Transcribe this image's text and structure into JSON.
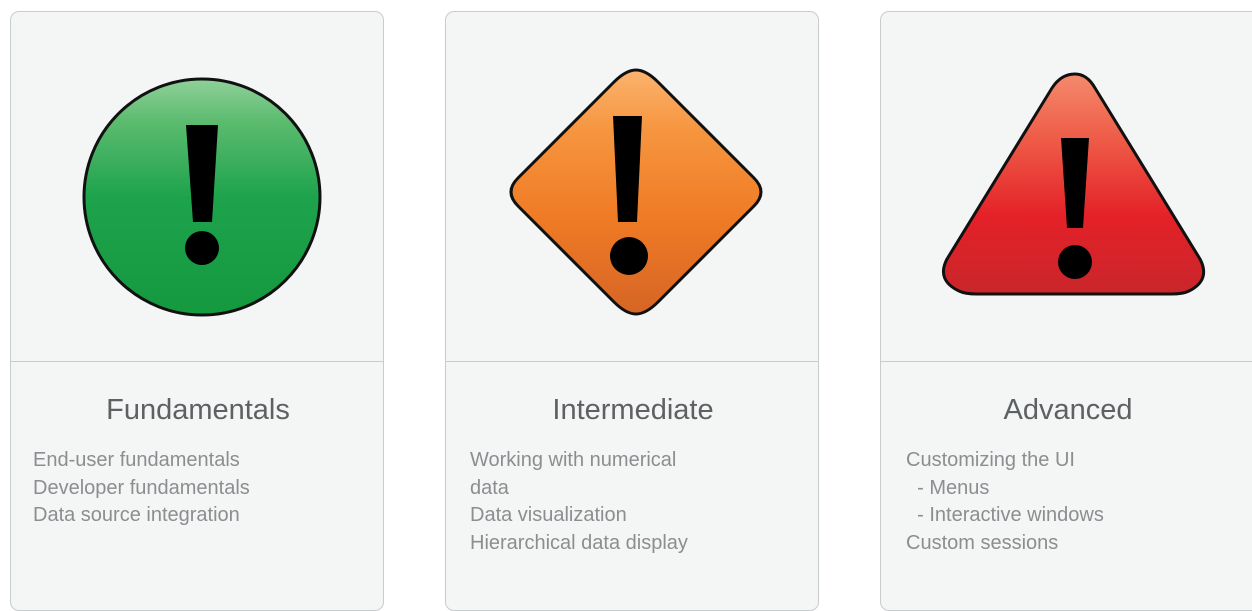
{
  "cards": [
    {
      "title": "Fundamentals",
      "icon": "green-circle-warning-icon",
      "items": [
        "End-user fundamentals",
        "Developer fundamentals",
        "Data source integration"
      ]
    },
    {
      "title": "Intermediate",
      "icon": "orange-diamond-warning-icon",
      "items": [
        "Working with numerical",
        "data",
        "Data visualization",
        "Hierarchical data display"
      ]
    },
    {
      "title": "Advanced",
      "icon": "red-triangle-warning-icon",
      "items": [
        "Customizing the UI",
        "  - Menus",
        "  - Interactive windows",
        "Custom sessions"
      ]
    }
  ],
  "colors": {
    "card_background": "#f4f5f5",
    "card_border": "#c9cccd",
    "title_text": "#5e6163",
    "item_text": "#8b8e90",
    "green": "#1aa14a",
    "orange": "#f07d2a",
    "red": "#e2242a"
  }
}
